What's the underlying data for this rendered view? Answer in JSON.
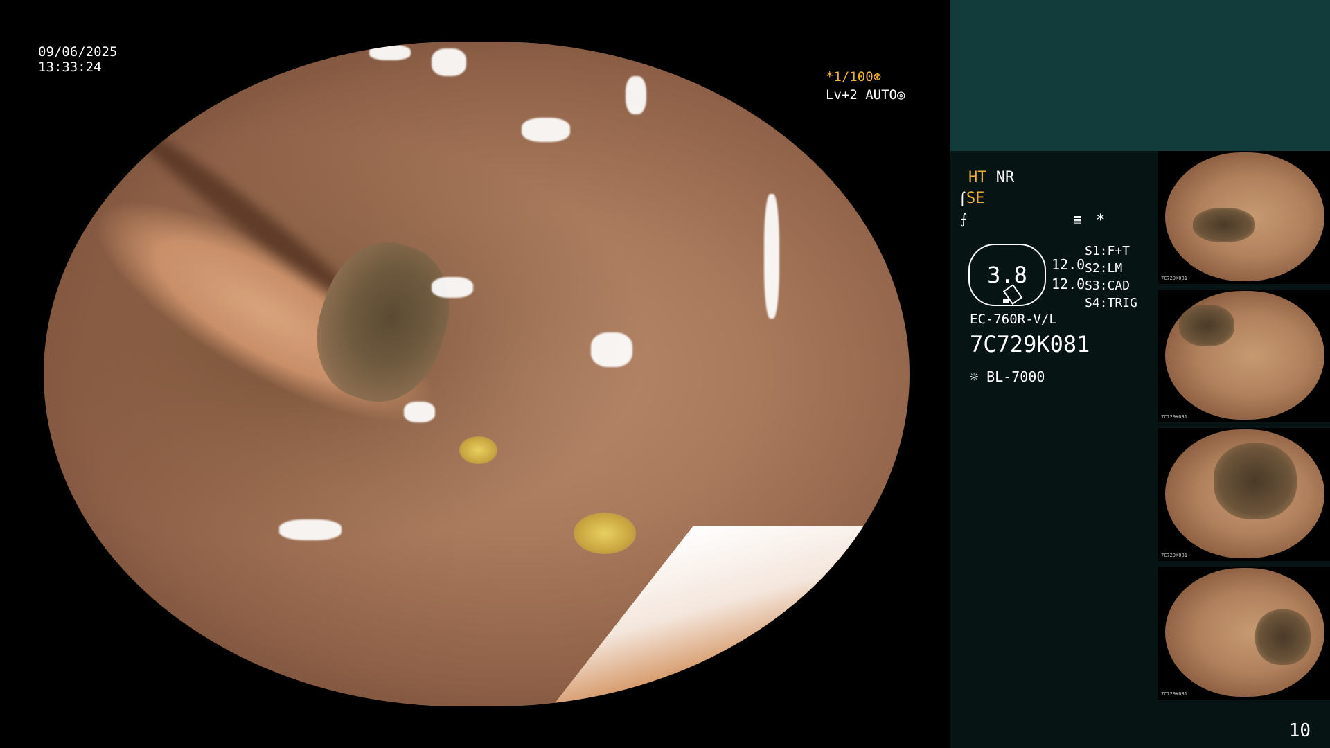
{
  "overlay": {
    "date": "09/06/2025",
    "time": "13:33:24",
    "shutter": "*1/100⊛",
    "level": "Lv+2 AUTO◎"
  },
  "info": {
    "mode_ht": "HT",
    "mode_nr": "NR",
    "se_label": "SE",
    "structure_icon": "⫳",
    "gauge_value": "3.8",
    "value_a": "12.0",
    "value_b": "12.0",
    "switches": [
      "S1:F+T",
      "S2:LM",
      "S3:CAD",
      "S4:TRIG"
    ],
    "scope_model": "EC-760R-V/L",
    "serial": "7C729K081",
    "light_source": "BL-7000",
    "asterisk": "*"
  },
  "thumbnail_label": "7C729K081",
  "page_number": "10"
}
